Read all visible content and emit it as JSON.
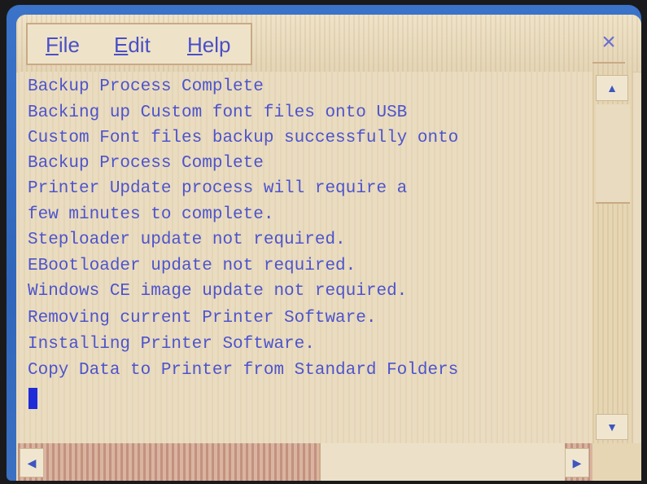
{
  "menu": {
    "file": {
      "label": "File",
      "accel": "F",
      "rest": "ile"
    },
    "edit": {
      "label": "Edit",
      "accel": "E",
      "rest": "dit"
    },
    "help": {
      "label": "Help",
      "accel": "H",
      "rest": "elp"
    }
  },
  "window": {
    "close_glyph": "×"
  },
  "log_lines": [
    "Backup Process Complete",
    "Backing up Custom font files onto USB",
    "Custom Font files backup successfully onto",
    "Backup Process Complete",
    "Printer Update process will require a",
    "few minutes to complete.",
    "Steploader update not required.",
    "EBootloader update not required.",
    "Windows CE image update not required.",
    "Removing current Printer Software.",
    "Installing Printer Software.",
    "Copy Data to Printer from Standard Folders"
  ],
  "scroll": {
    "up_glyph": "▲",
    "down_glyph": "▼",
    "left_glyph": "◀",
    "right_glyph": "▶"
  },
  "colors": {
    "text": "#4d54cc",
    "background": "#eadcc0",
    "bezel": "#2f66bb",
    "caret": "#1f2bd8"
  }
}
